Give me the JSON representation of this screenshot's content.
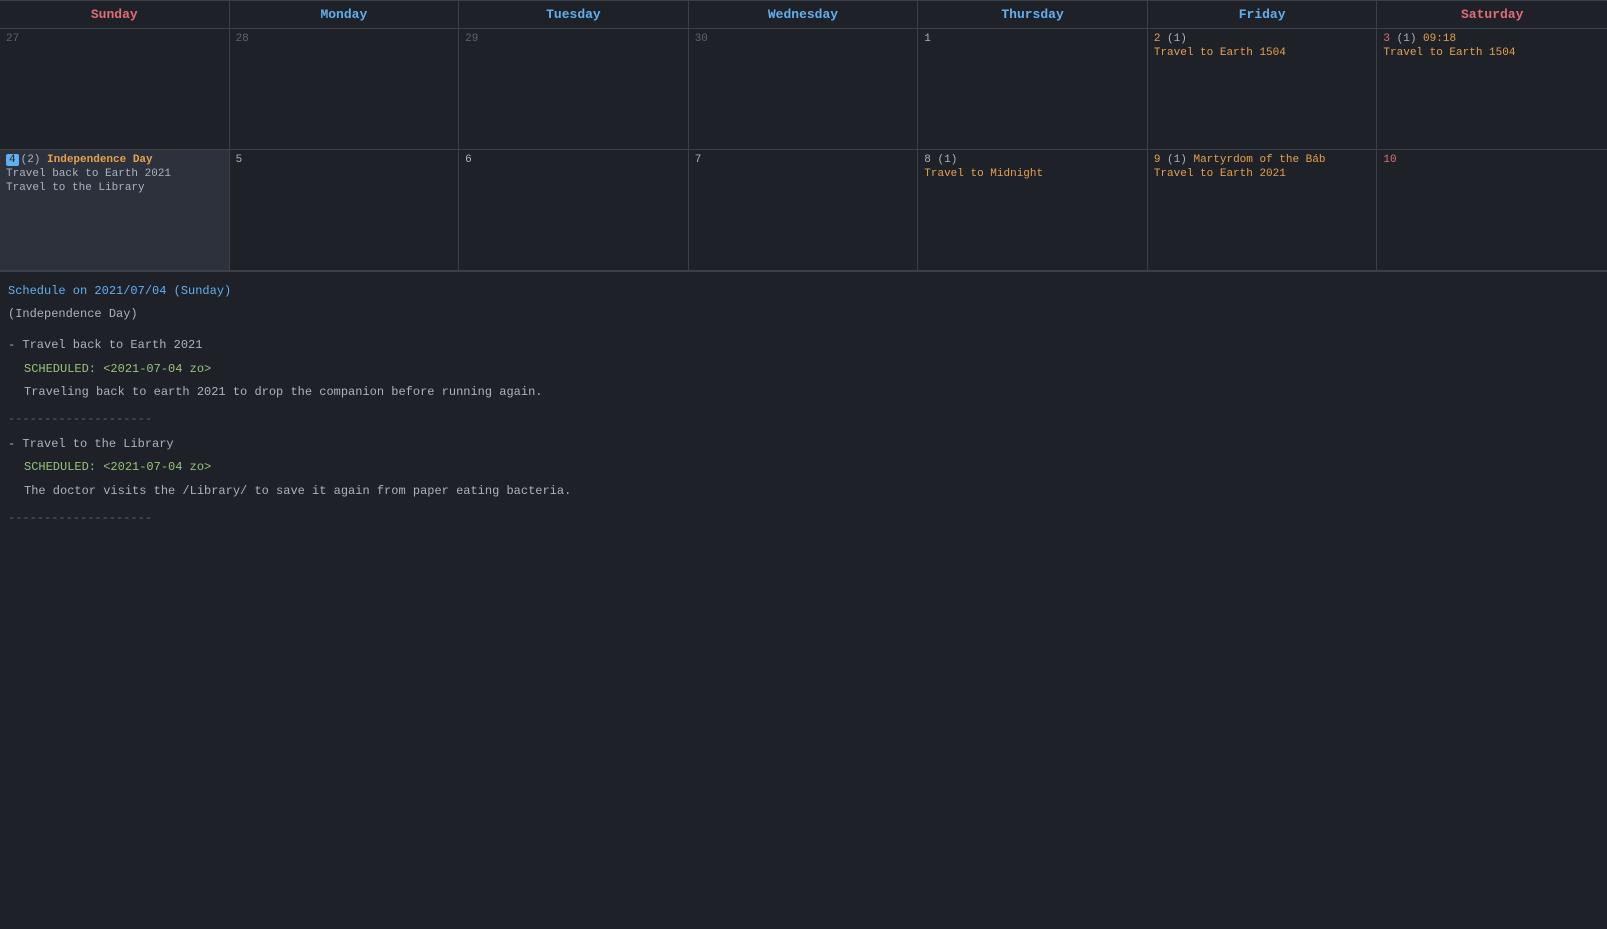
{
  "calendar": {
    "headers": [
      {
        "label": "Sunday",
        "class": "sunday-header"
      },
      {
        "label": "Monday",
        "class": "monday-header"
      },
      {
        "label": "Tuesday",
        "class": "tuesday-header"
      },
      {
        "label": "Wednesday",
        "class": "wednesday-header"
      },
      {
        "label": "Thursday",
        "class": "thursday-header"
      },
      {
        "label": "Friday",
        "class": "friday-header"
      },
      {
        "label": "Saturday",
        "class": "saturday-header"
      }
    ],
    "weeks": [
      {
        "cells": [
          {
            "day": "27",
            "type": "outside",
            "events": []
          },
          {
            "day": "28",
            "type": "outside",
            "events": []
          },
          {
            "day": "29",
            "type": "outside",
            "events": []
          },
          {
            "day": "30",
            "type": "outside",
            "events": []
          },
          {
            "day": "1",
            "type": "current",
            "events": []
          },
          {
            "day": "2",
            "count": "(1)",
            "type": "orange",
            "events": [
              {
                "text": "Travel to Earth 1504",
                "color": "orange"
              }
            ]
          },
          {
            "day": "3",
            "count": "(1)",
            "type": "red",
            "time": "09:18",
            "events": [
              {
                "text": "Travel to Earth 1504",
                "color": "orange"
              }
            ]
          }
        ]
      },
      {
        "cells": [
          {
            "day": "4",
            "count": "(2)",
            "type": "selected",
            "badge": true,
            "label": "Independence Day",
            "events": [
              {
                "text": "Travel back to Earth 2021",
                "color": "normal"
              },
              {
                "text": "Travel to the Library",
                "color": "normal"
              }
            ]
          },
          {
            "day": "5",
            "type": "current",
            "events": []
          },
          {
            "day": "6",
            "type": "current",
            "events": []
          },
          {
            "day": "7",
            "type": "current",
            "events": []
          },
          {
            "day": "8",
            "count": "(1)",
            "type": "current",
            "events": [
              {
                "text": "Travel to Midnight",
                "color": "orange"
              }
            ]
          },
          {
            "day": "9",
            "count": "(1)",
            "type": "orange",
            "label": "Martyrdom of the Báb",
            "events": [
              {
                "text": "Travel to Earth 2021",
                "color": "orange"
              }
            ]
          },
          {
            "day": "10",
            "type": "red",
            "events": []
          }
        ]
      }
    ]
  },
  "schedule": {
    "title": "Schedule on 2021/07/04 (Sunday)",
    "subtitle": "(Independence Day)",
    "entries": [
      {
        "title": "- Travel back to Earth 2021",
        "scheduled": "SCHEDULED: <2021-07-04 zo>",
        "desc": "Traveling back to earth 2021 to drop the companion before running again."
      },
      {
        "title": "- Travel to the Library",
        "scheduled": "SCHEDULED: <2021-07-04 zo>",
        "desc": "The doctor visits the /Library/ to save it again from paper eating bacteria."
      }
    ],
    "divider": "--------------------"
  }
}
